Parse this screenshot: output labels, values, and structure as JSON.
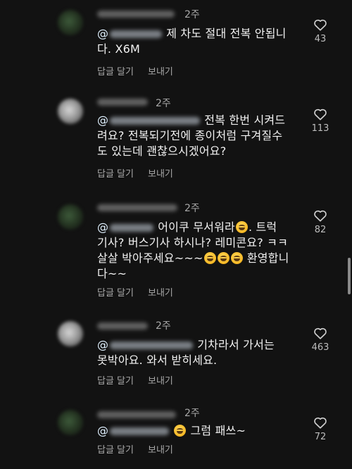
{
  "comments": [
    {
      "time": "2주",
      "mention_at": "@",
      "text_lines": [
        "제 차도 절대 전복 안됩니",
        "다. X6M"
      ],
      "reply": "답글 달기",
      "send": "보내기",
      "likes": "43"
    },
    {
      "time": "2주",
      "mention_at": "@",
      "text_lines": [
        "전복 한번 시켜드",
        "려요? 전복되기전에 종이처럼 구겨질수",
        "도 있는데 괜찮으시겠어요?"
      ],
      "reply": "답글 달기",
      "send": "보내기",
      "likes": "113"
    },
    {
      "time": "2주",
      "mention_at": "@",
      "line1": "어이쿠 무서워라",
      "line1b": ". 트럭",
      "line2": "기사? 버스기사 하시나? 레미콘요? ㅋㅋ",
      "line3a": "살살 박아주세요~~~",
      "line3b": " 환영합니",
      "line4": "다~~",
      "reply": "답글 달기",
      "send": "보내기",
      "likes": "82"
    },
    {
      "time": "2주",
      "mention_at": "@",
      "text_lines": [
        "기차라서 가서는",
        "못박아요. 와서 받히세요."
      ],
      "reply": "답글 달기",
      "send": "보내기",
      "likes": "463"
    },
    {
      "time": "2주",
      "mention_at": "@",
      "text_after_emoji": " 그럼 패쓰~",
      "reply": "답글 달기",
      "send": "보내기",
      "likes": "72"
    }
  ],
  "icons": {
    "like": "heart-outline-icon",
    "emoji": "grinning-sweat-emoji-icon"
  },
  "colors": {
    "background": "#121212",
    "text": "#f2f2f2",
    "secondary": "#a8a8a8"
  }
}
